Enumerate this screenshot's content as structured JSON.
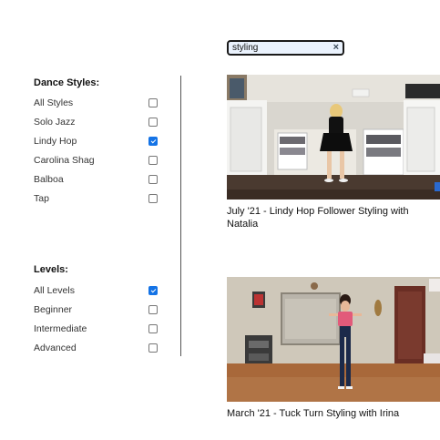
{
  "search": {
    "value": "styling",
    "clear_icon": "×"
  },
  "dance_styles": {
    "title": "Dance Styles:",
    "options": [
      {
        "label": "All Styles",
        "checked": false
      },
      {
        "label": "Solo Jazz",
        "checked": false
      },
      {
        "label": "Lindy Hop",
        "checked": true
      },
      {
        "label": "Carolina Shag",
        "checked": false
      },
      {
        "label": "Balboa",
        "checked": false
      },
      {
        "label": "Tap",
        "checked": false
      }
    ]
  },
  "levels": {
    "title": "Levels:",
    "options": [
      {
        "label": "All Levels",
        "checked": true
      },
      {
        "label": "Beginner",
        "checked": false
      },
      {
        "label": "Intermediate",
        "checked": false
      },
      {
        "label": "Advanced",
        "checked": false
      }
    ]
  },
  "videos": [
    {
      "title": "July '21 - Lindy Hop Follower Styling with Natalia"
    },
    {
      "title": "March '21 - Tuck Turn Styling with Irina"
    }
  ],
  "colors": {
    "checkbox_checked": "#1473e6",
    "search_bg": "#eaf2fd"
  }
}
